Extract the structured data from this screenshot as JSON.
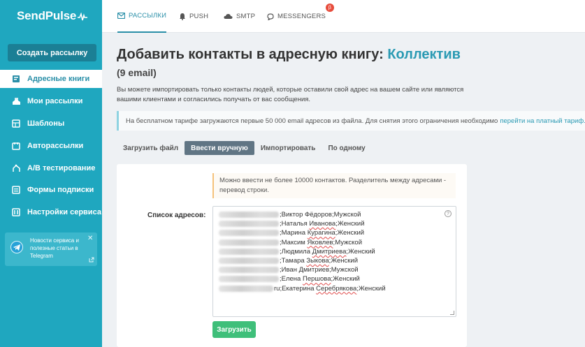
{
  "sidebar": {
    "logo": "SendPulse",
    "create_button": "Создать рассылку",
    "items": [
      {
        "label": "Адресные книги",
        "icon": "address-book-icon",
        "active": true
      },
      {
        "label": "Мои рассылки",
        "icon": "campaigns-icon",
        "active": false
      },
      {
        "label": "Шаблоны",
        "icon": "templates-icon",
        "active": false
      },
      {
        "label": "Авторассылки",
        "icon": "automation-icon",
        "active": false
      },
      {
        "label": "A/B тестирование",
        "icon": "ab-test-icon",
        "active": false
      },
      {
        "label": "Формы подписки",
        "icon": "forms-icon",
        "active": false
      },
      {
        "label": "Настройки сервиса",
        "icon": "settings-icon",
        "active": false
      }
    ],
    "telegram_card": {
      "text": "Новости сервиса и полезные статьи в Telegram"
    }
  },
  "topnav": {
    "tabs": [
      {
        "label": "РАССЫЛКИ",
        "icon": "mail-icon",
        "active": true
      },
      {
        "label": "PUSH",
        "icon": "bell-icon",
        "active": false
      },
      {
        "label": "SMTP",
        "icon": "cloud-icon",
        "active": false
      },
      {
        "label": "MESSENGERS",
        "icon": "chat-icon",
        "active": false,
        "badge": "β"
      }
    ]
  },
  "page": {
    "title": "Добавить контакты в адресную книгу:",
    "book_name": "Коллектив",
    "count": "(9 email)",
    "description": "Вы можете импортировать только контакты людей, которые оставили свой адрес на вашем сайте или являются вашими клиентами и согласились получать от вас сообщения.",
    "notice_text": "На бесплатном тарифе загружаются первые 50 000 email адресов из файла. Для снятия этого ограничения необходимо",
    "notice_link": "перейти на платный тариф."
  },
  "subtabs": [
    {
      "label": "Загрузить файл",
      "active": false
    },
    {
      "label": "Ввести вручную",
      "active": true
    },
    {
      "label": "Импортировать",
      "active": false
    },
    {
      "label": "По одному",
      "active": false
    }
  ],
  "form": {
    "warning": "Можно ввести не более 10000 контактов. Разделитель между адресами - перевод строки.",
    "list_label": "Список адресов:",
    "help": "?",
    "lines": [
      {
        "blur_width": 86,
        "tail": "",
        "first": "Виктор",
        "last": "Фёдоров",
        "gender": "Мужской",
        "underline": false
      },
      {
        "blur_width": 86,
        "tail": "",
        "first": "Наталья",
        "last": "Иванова",
        "gender": "Женский",
        "underline": true
      },
      {
        "blur_width": 86,
        "tail": "",
        "first": "Марина",
        "last": "Курагина",
        "gender": "Женский",
        "underline": true
      },
      {
        "blur_width": 86,
        "tail": "",
        "first": "Максим",
        "last": "Яковлев",
        "gender": "Мужской",
        "underline": true
      },
      {
        "blur_width": 86,
        "tail": "",
        "first": "Людмила",
        "last": "Дмитриева",
        "gender": "Женский",
        "underline": true
      },
      {
        "blur_width": 86,
        "tail": "",
        "first": "Тамара",
        "last": "Зыкова",
        "gender": "Женский",
        "underline": true
      },
      {
        "blur_width": 86,
        "tail": "",
        "first": "Иван",
        "last": "Дмитриев",
        "gender": "Мужской",
        "underline": false
      },
      {
        "blur_width": 86,
        "tail": "",
        "first": "Елена",
        "last": "Першова",
        "gender": "Женский",
        "underline": true
      },
      {
        "blur_width": 78,
        "tail": "ru",
        "first": "Екатерина",
        "last": "Серебрякова",
        "gender": "Женский",
        "underline": true
      }
    ],
    "upload_button": "Загрузить"
  },
  "colors": {
    "sidebar": "#1fa7bf",
    "accent": "#2a9ab3",
    "green": "#3fbf7a",
    "active_subtab": "#607584"
  }
}
